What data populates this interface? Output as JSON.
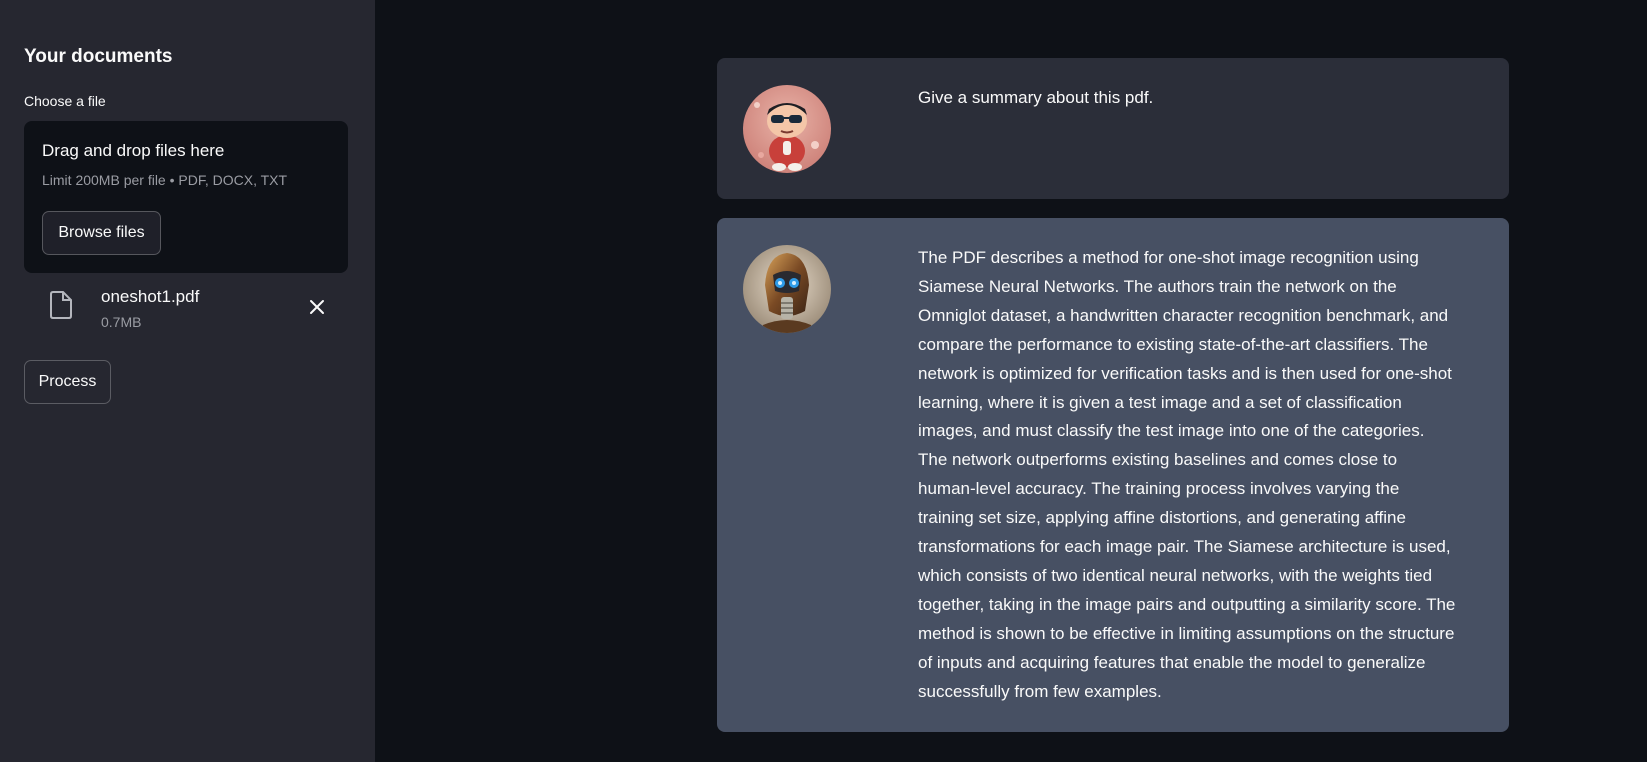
{
  "sidebar": {
    "title": "Your documents",
    "uploader_label": "Choose a file",
    "dropzone": {
      "title": "Drag and drop files here",
      "limit": "Limit 200MB per file • PDF, DOCX, TXT",
      "browse_label": "Browse files"
    },
    "file": {
      "name": "oneshot1.pdf",
      "size": "0.7MB"
    },
    "process_label": "Process"
  },
  "chat": {
    "messages": [
      {
        "role": "user",
        "avatar": "cartoon-boy-sunglasses-avatar",
        "text": "Give a summary about this pdf."
      },
      {
        "role": "bot",
        "avatar": "robot-avatar",
        "text": "The PDF describes a method for one-shot image recognition using Siamese Neural Networks. The authors train the network on the Omniglot dataset, a handwritten character recognition benchmark, and compare the performance to existing state-of-the-art classifiers. The network is optimized for verification tasks and is then used for one-shot learning, where it is given a test image and a set of classification images, and must classify the test image into one of the categories. The network outperforms existing baselines and comes close to human-level accuracy. The training process involves varying the training set size, applying affine distortions, and generating affine transformations for each image pair. The Siamese architecture is used, which consists of two identical neural networks, with the weights tied together, taking in the image pairs and outputting a similarity score. The method is shown to be effective in limiting assumptions on the structure of inputs and acquiring features that enable the model to generalize successfully from few examples."
      }
    ]
  },
  "colors": {
    "app_background": "#0e1117",
    "sidebar_background": "#262730",
    "user_message_background": "#2b2e39",
    "bot_message_background": "#475063",
    "text": "#fafafa",
    "muted_text": "#9a9ca3"
  }
}
